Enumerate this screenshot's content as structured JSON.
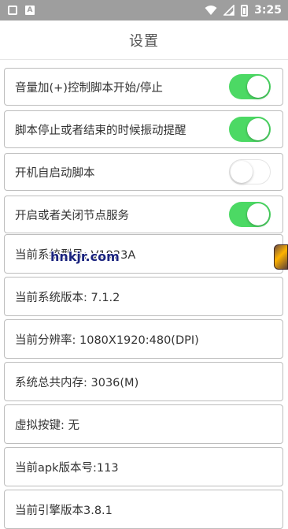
{
  "statusbar": {
    "time": "3:25",
    "icons": [
      "notification-square-icon",
      "app-a-icon",
      "wifi-icon",
      "signal-icon",
      "battery-icon"
    ]
  },
  "header": {
    "title": "设置"
  },
  "settings": [
    {
      "label": "音量加(+)控制脚本开始/停止",
      "toggle": true
    },
    {
      "label": "脚本停止或者结束的时候振动提醒",
      "toggle": true
    },
    {
      "label": "开机自启动脚本",
      "toggle": false
    },
    {
      "label": "开启或者关闭节点服务",
      "toggle": true
    }
  ],
  "info": [
    {
      "label": "当前系统型号: V1923A"
    },
    {
      "label": "当前系统版本: 7.1.2"
    },
    {
      "label": "当前分辨率: 1080X1920:480(DPI)"
    },
    {
      "label": "系统总共内存: 3036(M)"
    },
    {
      "label": "虚拟按键: 无"
    },
    {
      "label": "当前apk版本号:113"
    },
    {
      "label": "当前引擎版本3.8.1"
    }
  ],
  "watermark": "hnkjr.com",
  "colors": {
    "toggle_on": "#4cd964",
    "statusbar": "#9e9e9e",
    "border": "#bdbdbd"
  }
}
